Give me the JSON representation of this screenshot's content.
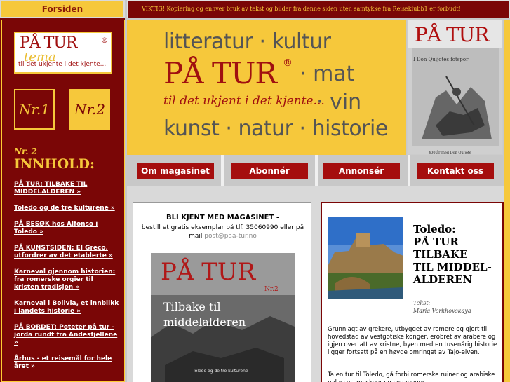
{
  "sidebar": {
    "forsiden": "Forsiden",
    "logo_title": "PÅ TUR",
    "logo_reg": "®",
    "logo_tema": "tema",
    "logo_sub": "til det ukjente i det kjente...",
    "issue1": "Nr.1",
    "issue2": "Nr.2",
    "issue_label": "Nr. 2",
    "innhold": "INNHOLD:",
    "toc": [
      "PÅ TUR: TILBAKE TIL MIDDELALDEREN »",
      "Toledo og de tre kulturene »",
      "PÅ BESØK hos Alfonso i Toledo »",
      "PÅ KUNSTSIDEN: El Greco, utfordrer av det etablerte »",
      "Karneval gjennom historien: fra romerske orgier til kristen tradisjon »",
      "Karneval i Bolivia, et innblikk i landets historie »",
      "PÅ BORDET: Poteter på tur - jorda rundt fra Andesfjellene »",
      "Århus - et reisemål for hele året »"
    ]
  },
  "notice": "VIKTIG! Kopiering og enhver bruk av tekst og bilder fra denne siden uten samtykke fra Reiseklubb1 er forbudt!",
  "banner": {
    "line1": "litteratur · kultur",
    "patur": "PÅ TUR",
    "reg": "®",
    "mat": "· mat",
    "tagline": "til det ukjent i det kjente...",
    "vin": "· vin",
    "line4": "kunst · natur · historie"
  },
  "cover": {
    "title": "PÅ TUR",
    "subtitle": "I Don Quijotes fotspor",
    "caption": "400 år med Don Quijote"
  },
  "nav": {
    "about": "Om magasinet",
    "subscribe": "Abonnér",
    "advertise": "Annonsér",
    "contact": "Kontakt oss"
  },
  "magazine": {
    "heading": "BLI KJENT MED MAGASINET -",
    "text": "bestill et gratis eksemplar på tlf. 35060990 eller på mail",
    "mail": "post@paa-tur.no",
    "cover_title": "PÅ TUR",
    "cover_issue": "Nr.2",
    "cover_sub1": "Tilbake til",
    "cover_sub2": "middelalderen",
    "cover_caption": "Toledo og de tre kulturene"
  },
  "article": {
    "title_lines": [
      "Toledo:",
      "PÅ TUR",
      "TILBAKE",
      "TIL MIDDEL-",
      "ALDEREN"
    ],
    "credit_label": "Tekst:",
    "credit_name": "Maria Verkhovskaya",
    "body": "Grunnlagt av grekere, utbygget av romere og gjort til hovedstad av vestgotiske konger, erobret av arabere og igjen overtatt av kristne, byen med en tusenårig historie ligger fortsatt på en høyde omringet av Tajo-elven.",
    "body2": "Ta en tur til Toledo, gå forbi romerske ruiner og arabiske palasser, moskeer og synagoger..."
  },
  "colors": {
    "maroon": "#7a0606",
    "gold": "#f6c83b",
    "button_red": "#a50e0e"
  }
}
